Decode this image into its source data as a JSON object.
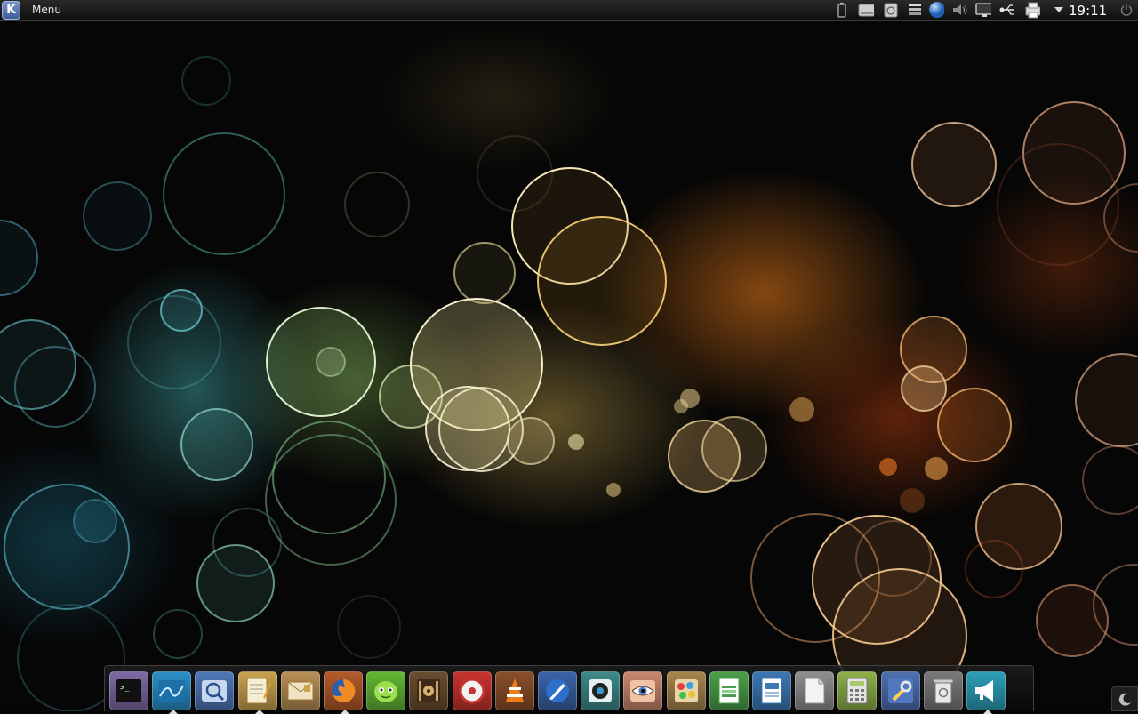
{
  "top_panel": {
    "launcher_letter": "K",
    "menu_label": "Menu",
    "tray_icons": [
      "battery-icon",
      "drive-icon",
      "trash-icon",
      "list-icon",
      "globe-icon",
      "volume-icon",
      "monitor-icon",
      "usb-icon",
      "printer-icon",
      "power-icon"
    ],
    "clock": "19:11"
  },
  "dock": {
    "apps": [
      {
        "name": "terminal-app",
        "color": "#7e6aa6"
      },
      {
        "name": "system-monitor-app",
        "color": "#2b8fc7",
        "running": true
      },
      {
        "name": "image-viewer-app",
        "color": "#4f77b7"
      },
      {
        "name": "text-editor-app",
        "color": "#c9a24f",
        "running": true
      },
      {
        "name": "mail-app",
        "color": "#b88f56"
      },
      {
        "name": "firefox-app",
        "color": "#b45a2b",
        "running": true
      },
      {
        "name": "chat-app",
        "color": "#63b735"
      },
      {
        "name": "video-editor-app",
        "color": "#6b4d2f"
      },
      {
        "name": "cd-player-app",
        "color": "#c7342f"
      },
      {
        "name": "vlc-app",
        "color": "#8a4f2a"
      },
      {
        "name": "browser-app",
        "color": "#3b63a7"
      },
      {
        "name": "camera-app",
        "color": "#3d8a8a"
      },
      {
        "name": "eye-app",
        "color": "#c7886d"
      },
      {
        "name": "paint-app",
        "color": "#a7854e"
      },
      {
        "name": "spreadsheet-app",
        "color": "#4aa04a"
      },
      {
        "name": "document-app",
        "color": "#3c78b5"
      },
      {
        "name": "blank-document-app",
        "color": "#8f8f8f"
      },
      {
        "name": "calculator-app",
        "color": "#8fb04a"
      },
      {
        "name": "settings-app",
        "color": "#4f6fb0"
      },
      {
        "name": "trash-app",
        "color": "#7a7a7a"
      },
      {
        "name": "announcer-app",
        "color": "#2c9fb8",
        "running": true
      }
    ]
  }
}
